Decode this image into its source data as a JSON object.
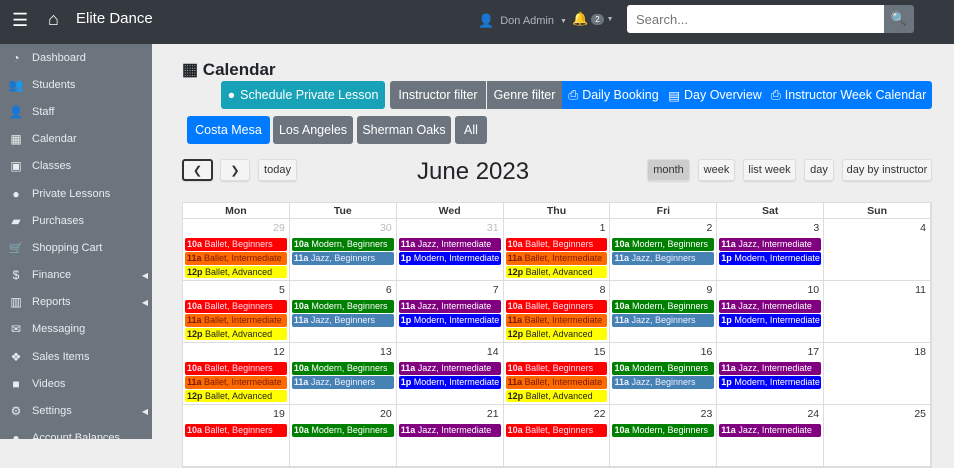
{
  "topbar": {
    "brand": "Elite Dance",
    "user": "Don Admin",
    "notifications": "2",
    "search_placeholder": "Search..."
  },
  "sidebar": {
    "items": [
      {
        "label": "Dashboard",
        "icon": "tachometer-icon",
        "glyph": "◔"
      },
      {
        "label": "Students",
        "icon": "users-icon",
        "glyph": "👥"
      },
      {
        "label": "Staff",
        "icon": "user-tie-icon",
        "glyph": "👤"
      },
      {
        "label": "Calendar",
        "icon": "calendar-icon",
        "glyph": "▦"
      },
      {
        "label": "Classes",
        "icon": "chalkboard-icon",
        "glyph": "▣"
      },
      {
        "label": "Private Lessons",
        "icon": "user-circle-icon",
        "glyph": "●"
      },
      {
        "label": "Purchases",
        "icon": "shopping-bag-icon",
        "glyph": "▰"
      },
      {
        "label": "Shopping Cart",
        "icon": "cart-icon",
        "glyph": "🛒"
      },
      {
        "label": "Finance",
        "icon": "dollar-icon",
        "glyph": "$",
        "submenu": true
      },
      {
        "label": "Reports",
        "icon": "chart-icon",
        "glyph": "▥",
        "submenu": true
      },
      {
        "label": "Messaging",
        "icon": "envelope-icon",
        "glyph": "✉"
      },
      {
        "label": "Sales Items",
        "icon": "cubes-icon",
        "glyph": "❖"
      },
      {
        "label": "Videos",
        "icon": "video-icon",
        "glyph": "■"
      },
      {
        "label": "Settings",
        "icon": "gear-icon",
        "glyph": "⚙",
        "submenu": true
      },
      {
        "label": "Account Balances",
        "icon": "account-icon",
        "glyph": "●"
      }
    ]
  },
  "page": {
    "title": "Calendar"
  },
  "toolbar": {
    "schedule": "Schedule Private Lesson",
    "instructor_filter": "Instructor filter",
    "genre_filter": "Genre filter",
    "daily_booking": "Daily Booking",
    "day_overview": "Day Overview",
    "instructor_week": "Instructor Week Calendar"
  },
  "locations": {
    "items": [
      "Costa Mesa",
      "Los Angeles",
      "Sherman Oaks",
      "All"
    ],
    "active": "Costa Mesa"
  },
  "calendar": {
    "title": "June 2023",
    "today": "today",
    "views": [
      "month",
      "week",
      "list week",
      "day",
      "day by instructor"
    ],
    "active_view": "month",
    "weekdays": [
      "Mon",
      "Tue",
      "Wed",
      "Thu",
      "Fri",
      "Sat",
      "Sun"
    ],
    "colors": {
      "red": "#ff0000",
      "orange": "#ff6a00",
      "yellow": "#ffff00",
      "green": "#008000",
      "steel": "#4682b4",
      "purple": "#800080",
      "blue": "#0000ff"
    },
    "weeks": [
      {
        "days": [
          {
            "n": "29",
            "other": true,
            "ev": [
              [
                "10a",
                "Ballet, Beginners",
                "red"
              ],
              [
                "11a",
                "Ballet, Intermediate",
                "orange"
              ],
              [
                "12p",
                "Ballet, Advanced",
                "yellow"
              ]
            ]
          },
          {
            "n": "30",
            "other": true,
            "ev": [
              [
                "10a",
                "Modern, Beginners",
                "green"
              ],
              [
                "11a",
                "Jazz, Beginners",
                "steel"
              ]
            ]
          },
          {
            "n": "31",
            "other": true,
            "ev": [
              [
                "11a",
                "Jazz, Intermediate",
                "purple"
              ],
              [
                "1p",
                "Modern, Intermediate",
                "blue"
              ]
            ]
          },
          {
            "n": "1",
            "ev": [
              [
                "10a",
                "Ballet, Beginners",
                "red"
              ],
              [
                "11a",
                "Ballet, Intermediate",
                "orange"
              ],
              [
                "12p",
                "Ballet, Advanced",
                "yellow"
              ]
            ]
          },
          {
            "n": "2",
            "ev": [
              [
                "10a",
                "Modern, Beginners",
                "green"
              ],
              [
                "11a",
                "Jazz, Beginners",
                "steel"
              ]
            ]
          },
          {
            "n": "3",
            "ev": [
              [
                "11a",
                "Jazz, Intermediate",
                "purple"
              ],
              [
                "1p",
                "Modern, Intermediate",
                "blue"
              ]
            ]
          },
          {
            "n": "4",
            "ev": []
          }
        ]
      },
      {
        "days": [
          {
            "n": "5",
            "ev": [
              [
                "10a",
                "Ballet, Beginners",
                "red"
              ],
              [
                "11a",
                "Ballet, Intermediate",
                "orange"
              ],
              [
                "12p",
                "Ballet, Advanced",
                "yellow"
              ]
            ]
          },
          {
            "n": "6",
            "ev": [
              [
                "10a",
                "Modern, Beginners",
                "green"
              ],
              [
                "11a",
                "Jazz, Beginners",
                "steel"
              ]
            ]
          },
          {
            "n": "7",
            "ev": [
              [
                "11a",
                "Jazz, Intermediate",
                "purple"
              ],
              [
                "1p",
                "Modern, Intermediate",
                "blue"
              ]
            ]
          },
          {
            "n": "8",
            "ev": [
              [
                "10a",
                "Ballet, Beginners",
                "red"
              ],
              [
                "11a",
                "Ballet, Intermediate",
                "orange"
              ],
              [
                "12p",
                "Ballet, Advanced",
                "yellow"
              ]
            ]
          },
          {
            "n": "9",
            "ev": [
              [
                "10a",
                "Modern, Beginners",
                "green"
              ],
              [
                "11a",
                "Jazz, Beginners",
                "steel"
              ]
            ]
          },
          {
            "n": "10",
            "ev": [
              [
                "11a",
                "Jazz, Intermediate",
                "purple"
              ],
              [
                "1p",
                "Modern, Intermediate",
                "blue"
              ]
            ]
          },
          {
            "n": "11",
            "ev": []
          }
        ]
      },
      {
        "days": [
          {
            "n": "12",
            "ev": [
              [
                "10a",
                "Ballet, Beginners",
                "red"
              ],
              [
                "11a",
                "Ballet, Intermediate",
                "orange"
              ],
              [
                "12p",
                "Ballet, Advanced",
                "yellow"
              ]
            ]
          },
          {
            "n": "13",
            "ev": [
              [
                "10a",
                "Modern, Beginners",
                "green"
              ],
              [
                "11a",
                "Jazz, Beginners",
                "steel"
              ]
            ]
          },
          {
            "n": "14",
            "ev": [
              [
                "11a",
                "Jazz, Intermediate",
                "purple"
              ],
              [
                "1p",
                "Modern, Intermediate",
                "blue"
              ]
            ]
          },
          {
            "n": "15",
            "ev": [
              [
                "10a",
                "Ballet, Beginners",
                "red"
              ],
              [
                "11a",
                "Ballet, Intermediate",
                "orange"
              ],
              [
                "12p",
                "Ballet, Advanced",
                "yellow"
              ]
            ]
          },
          {
            "n": "16",
            "ev": [
              [
                "10a",
                "Modern, Beginners",
                "green"
              ],
              [
                "11a",
                "Jazz, Beginners",
                "steel"
              ]
            ]
          },
          {
            "n": "17",
            "ev": [
              [
                "11a",
                "Jazz, Intermediate",
                "purple"
              ],
              [
                "1p",
                "Modern, Intermediate",
                "blue"
              ]
            ]
          },
          {
            "n": "18",
            "ev": []
          }
        ]
      },
      {
        "days": [
          {
            "n": "19",
            "ev": [
              [
                "10a",
                "Ballet, Beginners",
                "red"
              ]
            ]
          },
          {
            "n": "20",
            "ev": [
              [
                "10a",
                "Modern, Beginners",
                "green"
              ]
            ]
          },
          {
            "n": "21",
            "ev": [
              [
                "11a",
                "Jazz, Intermediate",
                "purple"
              ]
            ]
          },
          {
            "n": "22",
            "ev": [
              [
                "10a",
                "Ballet, Beginners",
                "red"
              ]
            ]
          },
          {
            "n": "23",
            "ev": [
              [
                "10a",
                "Modern, Beginners",
                "green"
              ]
            ]
          },
          {
            "n": "24",
            "ev": [
              [
                "11a",
                "Jazz, Intermediate",
                "purple"
              ]
            ]
          },
          {
            "n": "25",
            "ev": []
          }
        ]
      }
    ]
  }
}
